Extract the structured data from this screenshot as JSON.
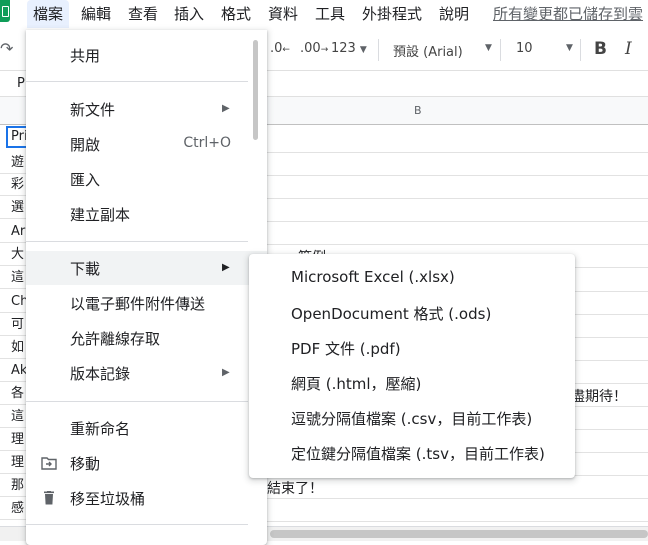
{
  "menubar": {
    "items": [
      {
        "label": "檔案",
        "active": true
      },
      {
        "label": "編輯"
      },
      {
        "label": "查看"
      },
      {
        "label": "插入"
      },
      {
        "label": "格式"
      },
      {
        "label": "資料"
      },
      {
        "label": "工具"
      },
      {
        "label": "外掛程式"
      },
      {
        "label": "說明"
      }
    ],
    "save_status": "所有變更都已儲存到雲"
  },
  "toolbar": {
    "decimal_decrease": ".0",
    "decimal_increase": ".00",
    "number_format": "123",
    "font": "預設 (Arial)",
    "font_size": "10",
    "bold": "B",
    "italic": "I"
  },
  "formula_bar": {
    "cell_ref": "P"
  },
  "grid": {
    "column_b": "B",
    "selected_cell": "Pri",
    "row_cells": [
      "遊",
      "彩",
      "選",
      "Ar",
      "大",
      "這",
      "Ch",
      "可",
      "如",
      "Ak",
      "各",
      "這",
      "理",
      "理",
      "那",
      "感"
    ],
    "text_fragments": {
      "row5_suffix": "範例",
      "row11_suffix": "盡期待！",
      "row15": "結束了！"
    }
  },
  "file_menu": {
    "items": [
      {
        "label": "共用"
      },
      {
        "label": "新文件",
        "has_submenu": true
      },
      {
        "label": "開啟",
        "shortcut": "Ctrl+O"
      },
      {
        "label": "匯入"
      },
      {
        "label": "建立副本"
      },
      {
        "label": "下載",
        "has_submenu": true,
        "highlighted": true
      },
      {
        "label": "以電子郵件附件傳送"
      },
      {
        "label": "允許離線存取"
      },
      {
        "label": "版本記錄",
        "has_submenu": true
      },
      {
        "label": "重新命名"
      },
      {
        "label": "移動",
        "icon": "folder-move-icon"
      },
      {
        "label": "移至垃圾桶",
        "icon": "trash-icon"
      }
    ]
  },
  "download_submenu": {
    "items": [
      {
        "label": "Microsoft Excel (.xlsx)"
      },
      {
        "label": "OpenDocument 格式 (.ods)"
      },
      {
        "label": "PDF 文件 (.pdf)"
      },
      {
        "label": "網頁 (.html，壓縮)"
      },
      {
        "label": "逗號分隔值檔案 (.csv，目前工作表)"
      },
      {
        "label": "定位鍵分隔值檔案 (.tsv，目前工作表)"
      }
    ]
  },
  "colors": {
    "accent": "#1a73e8",
    "app_green": "#0f9d58",
    "menu_active_bg": "#e8f0fe",
    "menu_hover_bg": "#f1f3f4"
  }
}
